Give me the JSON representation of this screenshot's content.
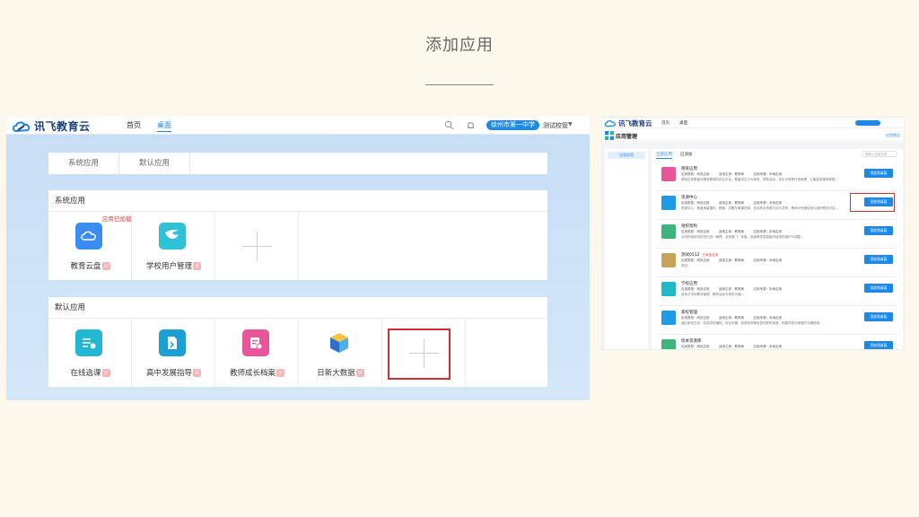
{
  "slide_title": "添加应用",
  "left": {
    "logo_text": "讯飞教育云",
    "nav": [
      "首页",
      "桌面"
    ],
    "school": "徐州市第一中学",
    "user": "测试校管",
    "tabs": [
      "系统应用",
      "默认应用"
    ],
    "system_section": {
      "title": "系统应用",
      "added_tag": "应用已加载",
      "apps": [
        {
          "label": "教育云盘",
          "color": "#3b8ef0",
          "icon": "cloud-icon"
        },
        {
          "label": "学校用户管理",
          "color": "#2fc1d6",
          "icon": "bird-icon"
        }
      ]
    },
    "default_section": {
      "title": "默认应用",
      "apps": [
        {
          "label": "在线选课",
          "color": "#21b7d4",
          "icon": "course-list-icon"
        },
        {
          "label": "高中发展指导",
          "color": "#1a9fd6",
          "icon": "guide-doc-icon"
        },
        {
          "label": "教师成长档案",
          "color": "#e8559a",
          "icon": "teacher-file-icon"
        },
        {
          "label": "日新大数据",
          "color": "#4e8fd8",
          "icon": "cube-icon"
        }
      ]
    },
    "badge_glyph": "×",
    "colors": {
      "accent": "#1e88e5",
      "highlight": "#d32f2f"
    }
  },
  "right": {
    "logo_text": "讯飞教育云",
    "nav": [
      "首页",
      "桌面"
    ],
    "header_title": "应用管理",
    "header_link": "应用商店",
    "side_item": "全部应用",
    "tabs": [
      "全部应用",
      "已添加"
    ],
    "search_placeholder": "请输入应用名称",
    "add_button_label": "添加到桌面",
    "items": [
      {
        "name": "德育应用",
        "tag": "",
        "color": "#e8559a",
        "meta": "应用类型：网页应用　　　适用主体：教育局　　　应用来源：本地应用",
        "desc": "德育应用是面向德育教育的综合平台，覆盖学生行为规范、德育活动、评价记录等日常管理，汇聚各类德育数据…"
      },
      {
        "name": "资源中心",
        "tag": "",
        "color": "#1e9be8",
        "meta": "应用类型：网页应用　　　适用主体：教育局　　　应用来源：本地应用",
        "desc": "资源中心，覆盖海量课件、教案、试题与微课资源，支持校本资源沉淀与共享，教师可快速检索与组织教学内容…"
      },
      {
        "name": "组织架构",
        "tag": "",
        "color": "#3bb57a",
        "meta": "应用类型：网页应用　　　适用主体：教育局　　　应用来源：本地应用",
        "desc": "对学校组织机构进行统一管理，支持部门、年级、班级等多层级组织结构的维护与调整…"
      },
      {
        "name": "测试0512",
        "tag": "已添加应用",
        "color": "#c9a25a",
        "meta": "应用类型：网页应用　　　适用主体：教育局　　　应用来源：本地应用",
        "desc": "测试"
      },
      {
        "name": "学校应用",
        "tag": "",
        "color": "#1fb9c9",
        "meta": "应用类型：网页应用　　　适用主体：教育局　　　应用来源：本地应用",
        "desc": "适用于学校教学管理、教研活动与家校沟通…"
      },
      {
        "name": "家校管理",
        "tag": "",
        "color": "#1e9be8",
        "meta": "应用类型：网页应用　　　适用主体：教育局　　　应用来源：本地应用",
        "desc": "通过家校互动，实现学校通知、作业布置、成绩查询等信息的即时传递，构建学校与家庭的沟通桥梁…"
      },
      {
        "name": "校本资源库",
        "tag": "",
        "color": "#3bb57a",
        "meta": "应用类型：网页应用　　　适用主体：教育局　　　应用来源：本地应用",
        "desc": ""
      }
    ]
  }
}
